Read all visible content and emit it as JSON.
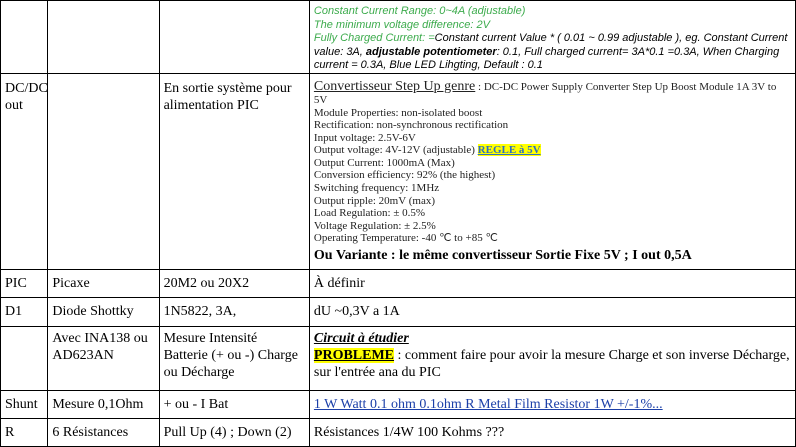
{
  "row0": {
    "line1": "Constant Current Range: 0~4A (adjustable)",
    "line2": "The minimum voltage difference: 2V",
    "line3": "Fully Charged Current: =",
    "line3b": "Constant current Value * ( 0.01 ~ 0.99 adjustable ), eg. Constant Current value: 3A, ",
    "line3bold": "adjustable potentiometer",
    "line3c": ": 0.1, Full charged current= 3A*0.1 =0.3A, When Charging current = 0.3A, Blue LED Lihgting, Default : 0.1"
  },
  "row1": {
    "c1": "DC/DC out",
    "c3": "En sortie système pour alimentation PIC",
    "title_u": "Convertisseur Step Up genre",
    "title_rest": " : DC-DC Power Supply Converter Step Up Boost Module 1A 3V to 5V",
    "specs_a": [
      "Module Properties: non-isolated boost",
      "Rectification: non-synchronous rectification",
      "Input voltage: 2.5V-6V"
    ],
    "output_voltage": "Output voltage: 4V-12V (adjustable) ",
    "regle": "REGLE à 5V",
    "specs_b": [
      "Output Current: 1000mA (Max)",
      "Conversion efficiency: 92% (the highest)",
      "Switching frequency: 1MHz",
      "Output ripple: 20mV (max)",
      "Load Regulation: ± 0.5%",
      "Voltage Regulation: ± 2.5%",
      "Operating Temperature: -40 ℃ to +85 ℃"
    ],
    "variant": "Ou Variante : le même convertisseur Sortie Fixe 5V ; I out 0,5A"
  },
  "row2": {
    "c1": "PIC",
    "c2": "Picaxe",
    "c3": "20M2 ou 20X2",
    "c4": "À définir"
  },
  "row3": {
    "c1": "D1",
    "c2": "Diode Shottky",
    "c3": "1N5822, 3A,",
    "c4": "dU  ~0,3V a 1A"
  },
  "row4": {
    "c2": "Avec INA138 ou AD623AN",
    "c3": "Mesure Intensité Batterie (+ ou -) Charge ou Décharge",
    "circuit": "Circuit à étudier",
    "probleme": "PROBLEME",
    "text": " : comment faire pour avoir la mesure Charge et son inverse Décharge, sur l'entrée ana du PIC"
  },
  "row5": {
    "c1": "Shunt",
    "c2": "Mesure 0,1Ohm",
    "c3": "+ ou - I Bat",
    "c4": "1 W Watt 0.1 ohm 0.1ohm R Metal Film Resistor 1W +/-1%..."
  },
  "row6": {
    "c1": "R",
    "c2": "6 Résistances",
    "c3": "Pull Up (4) ; Down (2)",
    "c4": "Résistances 1/4W 100 Kohms ???"
  }
}
